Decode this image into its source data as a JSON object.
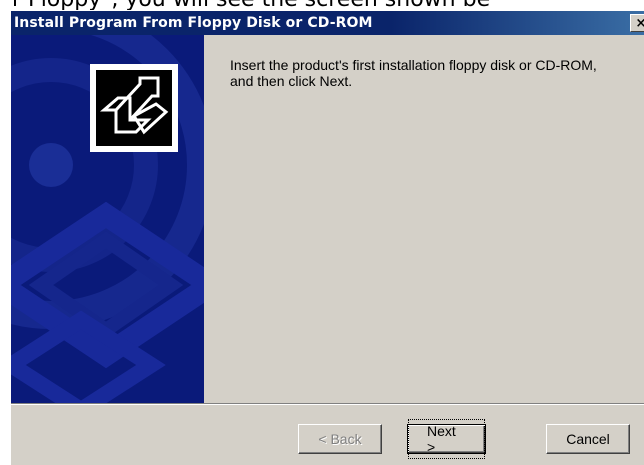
{
  "background_caption": "r Floppy\", you will see the screen shown be",
  "dialog": {
    "title": "Install Program From Floppy Disk or CD-ROM",
    "close_glyph": "×",
    "message_line1": "Insert the product's first installation floppy disk or CD-ROM,",
    "message_line2": "and then click Next.",
    "icon": "install-arrow-icon"
  },
  "buttons": {
    "back_label": "< Back",
    "next_label": "Next >",
    "cancel_label": "Cancel"
  },
  "colors": {
    "titlebar": "#0a246a",
    "face": "#d4d0c8",
    "banner": "#0a1a7a"
  }
}
